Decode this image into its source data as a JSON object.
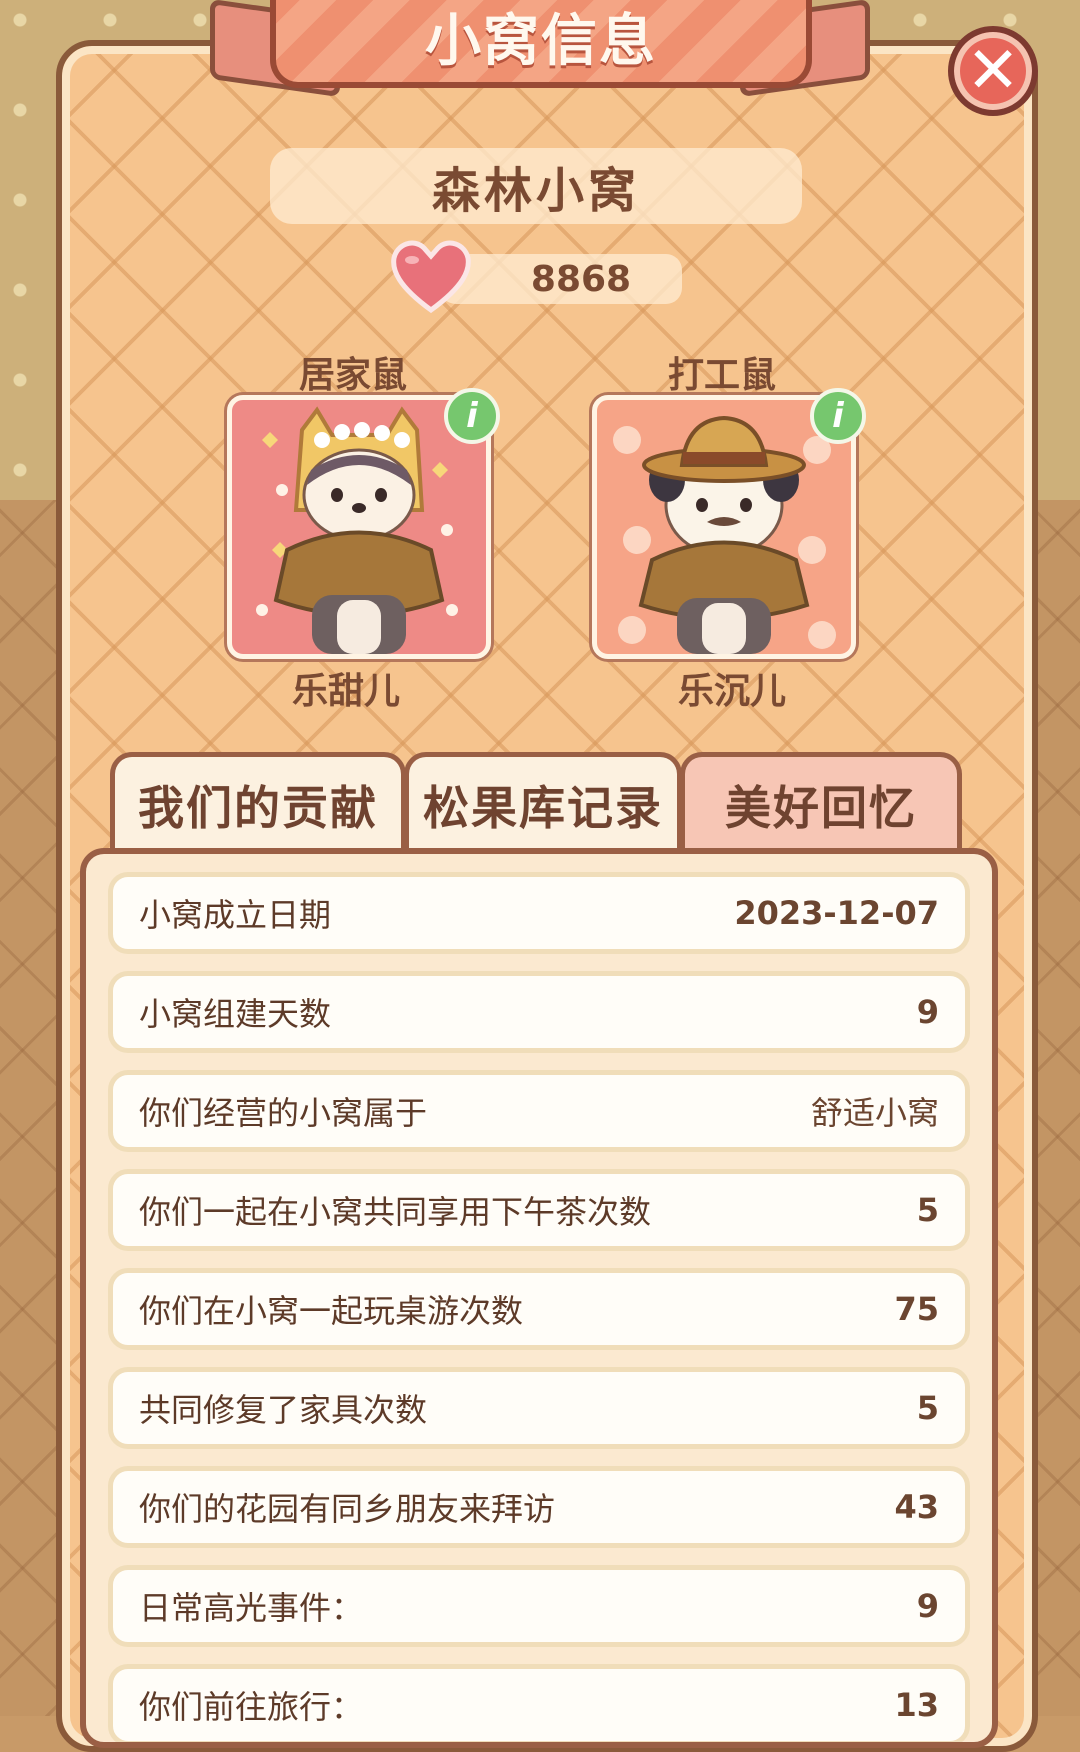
{
  "header": {
    "title": "小窝信息",
    "close_label": "✕"
  },
  "nest": {
    "name": "森林小窝",
    "hearts": "8868"
  },
  "members": [
    {
      "role": "居家鼠",
      "name": "乐甜儿",
      "info": "i"
    },
    {
      "role": "打工鼠",
      "name": "乐沉儿",
      "info": "i"
    }
  ],
  "tabs": [
    {
      "label": "我们的贡献"
    },
    {
      "label": "松果库记录"
    },
    {
      "label": "美好回忆"
    }
  ],
  "active_tab": "美好回忆",
  "stats": [
    {
      "label": "小窝成立日期",
      "value": "2023-12-07"
    },
    {
      "label": "小窝组建天数",
      "value": "9"
    },
    {
      "label": "你们经营的小窝属于",
      "value": "舒适小窝"
    },
    {
      "label": "你们一起在小窝共同享用下午茶次数",
      "value": "5"
    },
    {
      "label": "你们在小窝一起玩桌游次数",
      "value": "75"
    },
    {
      "label": "共同修复了家具次数",
      "value": "5"
    },
    {
      "label": "你们的花园有同乡朋友来拜访",
      "value": "43"
    },
    {
      "label": "日常高光事件：",
      "value": "9"
    },
    {
      "label": "你们前往旅行：",
      "value": "13"
    }
  ],
  "colors": {
    "accent": "#ef9070",
    "panel": "#f6c48e",
    "text": "#7a4a32",
    "info_badge": "#76c76e"
  }
}
